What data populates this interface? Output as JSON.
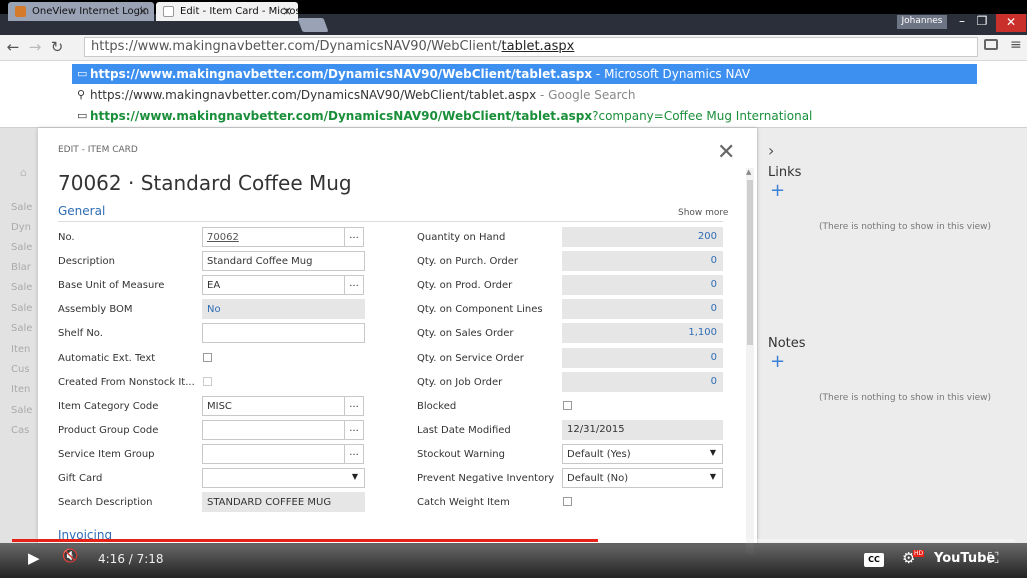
{
  "browser": {
    "tabs": [
      {
        "title": "OneView Internet Login",
        "close": "×"
      },
      {
        "title": "Edit - Item Card - Microso",
        "close": "×"
      }
    ],
    "user": "Johannes",
    "min": "–",
    "max": "❐",
    "close": "✕",
    "url_prefix": "https://www.makingnavbetter.com/DynamicsNAV90/WebClient/",
    "url_selected": "tablet.aspx",
    "suggestions": [
      {
        "bold": "https://www.makingnavbetter.com/DynamicsNAV90/WebClient/tablet.aspx",
        "rest": " - Microsoft Dynamics NAV"
      },
      {
        "bold": "https://www.makingnavbetter.com/DynamicsNAV90/WebClient/tablet.aspx",
        "rest": " - Google Search"
      },
      {
        "bold": "https://www.makingnavbetter.com/DynamicsNAV90/WebClient/tablet.aspx",
        "rest": "?company=Coffee Mug International"
      }
    ]
  },
  "background_page": {
    "sidebar": [
      "Sale",
      "Dyn",
      "Sale",
      "Blar",
      "Sale",
      "Sale",
      "Sale",
      "Iten",
      "Cus",
      "Iten",
      "Sale",
      "Cas"
    ]
  },
  "dialog": {
    "kicker": "EDIT - ITEM CARD",
    "close": "✕",
    "title": "70062 · Standard Coffee Mug",
    "section": "General",
    "show_more": "Show more",
    "left_fields": [
      {
        "label": "No.",
        "value": "70062",
        "kind": "input-dots"
      },
      {
        "label": "Description",
        "value": "Standard Coffee Mug",
        "kind": "input"
      },
      {
        "label": "Base Unit of Measure",
        "value": "EA",
        "kind": "input-dots"
      },
      {
        "label": "Assembly BOM",
        "value": "No",
        "kind": "link"
      },
      {
        "label": "Shelf No.",
        "value": "",
        "kind": "input"
      },
      {
        "label": "Automatic Ext. Text",
        "value": "",
        "kind": "check"
      },
      {
        "label": "Created From Nonstock It...",
        "value": "",
        "kind": "check-dis"
      },
      {
        "label": "Item Category Code",
        "value": "MISC",
        "kind": "input-dots"
      },
      {
        "label": "Product Group Code",
        "value": "",
        "kind": "input-dots"
      },
      {
        "label": "Service Item Group",
        "value": "",
        "kind": "input-dots"
      },
      {
        "label": "Gift Card",
        "value": "",
        "kind": "select"
      },
      {
        "label": "Search Description",
        "value": "STANDARD COFFEE MUG",
        "kind": "input-ro"
      }
    ],
    "right_fields": [
      {
        "label": "Quantity on Hand",
        "value": "200",
        "kind": "num"
      },
      {
        "label": "Qty. on Purch. Order",
        "value": "0",
        "kind": "num"
      },
      {
        "label": "Qty. on Prod. Order",
        "value": "0",
        "kind": "num"
      },
      {
        "label": "Qty. on Component Lines",
        "value": "0",
        "kind": "num"
      },
      {
        "label": "Qty. on Sales Order",
        "value": "1,100",
        "kind": "num"
      },
      {
        "label": "Qty. on Service Order",
        "value": "0",
        "kind": "num"
      },
      {
        "label": "Qty. on Job Order",
        "value": "0",
        "kind": "num"
      },
      {
        "label": "Blocked",
        "value": "",
        "kind": "check"
      },
      {
        "label": "Last Date Modified",
        "value": "12/31/2015",
        "kind": "num-dark"
      },
      {
        "label": "Stockout Warning",
        "value": "Default (Yes)",
        "kind": "select"
      },
      {
        "label": "Prevent Negative Inventory",
        "value": "Default (No)",
        "kind": "select"
      },
      {
        "label": "Catch Weight Item",
        "value": "",
        "kind": "check"
      }
    ],
    "dots": "...",
    "select_arrow": "▼",
    "next_section": "Invoicing"
  },
  "right_panel": {
    "chevron": "›",
    "links_title": "Links",
    "links_empty": "(There is nothing to show in this view)",
    "notes_title": "Notes",
    "notes_empty": "(There is nothing to show in this view)",
    "plus": "+"
  },
  "video": {
    "current": "4:16",
    "duration": "7:18",
    "time_text": "4:16 / 7:18",
    "progress": 0.584,
    "play": "▶",
    "volume": "🔇",
    "cc": "CC",
    "hd": "HD",
    "logo": "YouTube",
    "fullscreen": "⛶"
  }
}
